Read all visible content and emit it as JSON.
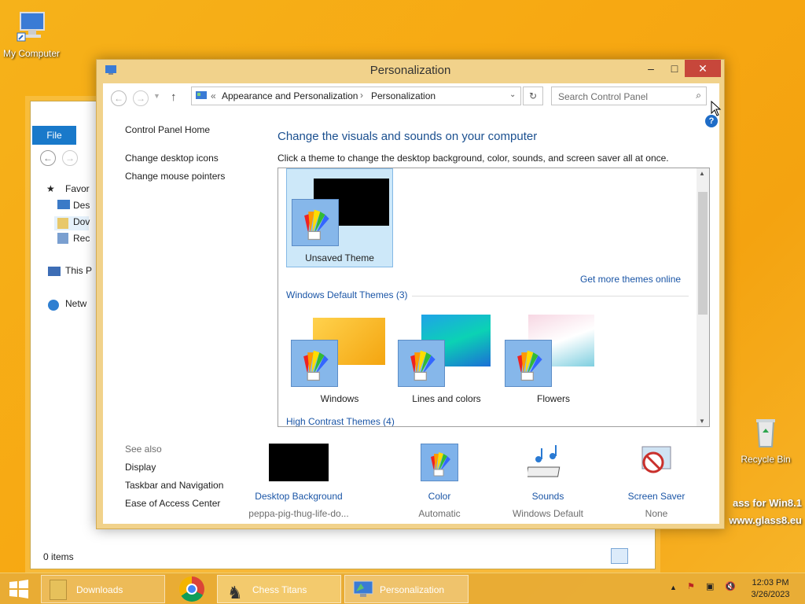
{
  "desktop": {
    "icons": [
      {
        "label": "My Computer"
      },
      {
        "label": "Recycle Bin"
      }
    ],
    "watermark_line1": "ass for Win8.1",
    "watermark_line2": "www.glass8.eu"
  },
  "explorer": {
    "file_tab": "File",
    "nav": [
      "Favor",
      "Des",
      "Dov",
      "Rec",
      "This P",
      "Netw"
    ],
    "status": "0 items"
  },
  "window": {
    "title": "Personalization",
    "controls": {
      "minimize": "–",
      "maximize": "□",
      "close": "✕"
    },
    "breadcrumb": [
      "«",
      "Appearance and Personalization",
      "›",
      "Personalization"
    ],
    "search_placeholder": "Search Control Panel",
    "left_nav": {
      "home": "Control Panel Home",
      "links": [
        "Change desktop icons",
        "Change mouse pointers"
      ],
      "see_also_label": "See also",
      "see_also": [
        "Display",
        "Taskbar and Navigation",
        "Ease of Access Center"
      ]
    },
    "heading": "Change the visuals and sounds on your computer",
    "subheading": "Click a theme to change the desktop background, color, sounds, and screen saver all at once.",
    "my_themes": [
      {
        "label": "Unsaved Theme",
        "selected": true
      }
    ],
    "get_more_link": "Get more themes online",
    "default_group_label": "Windows Default Themes (3)",
    "default_themes": [
      {
        "label": "Windows"
      },
      {
        "label": "Lines and colors"
      },
      {
        "label": "Flowers"
      }
    ],
    "high_contrast_label": "High Contrast Themes (4)",
    "bottom": [
      {
        "label": "Desktop Background",
        "value": "peppa-pig-thug-life-do..."
      },
      {
        "label": "Color",
        "value": "Automatic"
      },
      {
        "label": "Sounds",
        "value": "Windows Default"
      },
      {
        "label": "Screen Saver",
        "value": "None"
      }
    ]
  },
  "taskbar": {
    "buttons": [
      {
        "label": "Downloads"
      },
      {
        "label": "Chess Titans"
      },
      {
        "label": "Personalization"
      }
    ],
    "time": "12:03 PM",
    "date": "3/26/2023"
  },
  "colors": {
    "accent": "#f7ab16",
    "link": "#1a55a6",
    "selected_theme": "#cde8f9"
  }
}
